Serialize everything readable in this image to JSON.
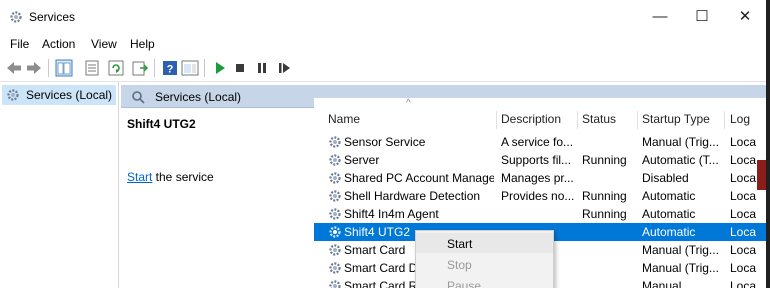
{
  "window": {
    "title": "Services",
    "controls": {
      "minimize": "—",
      "maximize": "☐",
      "close": "✕"
    }
  },
  "menu": [
    "File",
    "Action",
    "View",
    "Help"
  ],
  "tree": {
    "selected_label": "Services (Local)"
  },
  "header": {
    "title": "Services (Local)"
  },
  "details": {
    "service_title": "Shift4 UTG2",
    "start_link": "Start",
    "start_suffix": " the service"
  },
  "table": {
    "columns": [
      "Name",
      "Description",
      "Status",
      "Startup Type",
      "Log"
    ],
    "sort_indicator": "^",
    "rows": [
      {
        "name": "Sensor Service",
        "description": "A service fo...",
        "status": "",
        "startup": "Manual (Trig...",
        "log": "Loca"
      },
      {
        "name": "Server",
        "description": "Supports fil...",
        "status": "Running",
        "startup": "Automatic (T...",
        "log": "Loca"
      },
      {
        "name": "Shared PC Account Manager",
        "description": "Manages pr...",
        "status": "",
        "startup": "Disabled",
        "log": "Loca"
      },
      {
        "name": "Shell Hardware Detection",
        "description": "Provides no...",
        "status": "Running",
        "startup": "Automatic",
        "log": "Loca"
      },
      {
        "name": "Shift4 In4m Agent",
        "description": "",
        "status": "Running",
        "startup": "Automatic",
        "log": "Loca"
      },
      {
        "name": "Shift4 UTG2",
        "description": "",
        "status": "",
        "startup": "Automatic",
        "log": "Loca"
      },
      {
        "name": "Smart Card",
        "description": "c...",
        "status": "",
        "startup": "Manual (Trig...",
        "log": "Loca"
      },
      {
        "name": "Smart Card D",
        "description": "c...",
        "status": "",
        "startup": "Manual (Trig...",
        "log": "Loca"
      },
      {
        "name": "Smart Card Re",
        "description": "",
        "status": "",
        "startup": "Manual",
        "log": "Loca"
      }
    ],
    "selected_index": 5
  },
  "context_menu": {
    "items": [
      {
        "label": "Start",
        "enabled": true
      },
      {
        "label": "Stop",
        "enabled": false
      },
      {
        "label": "Pause",
        "enabled": false
      }
    ]
  },
  "colors": {
    "selection": "#0078d7",
    "header_band": "#c6d6e8",
    "tree_selection": "#cce4f7",
    "play_green": "#1a9b3c"
  }
}
